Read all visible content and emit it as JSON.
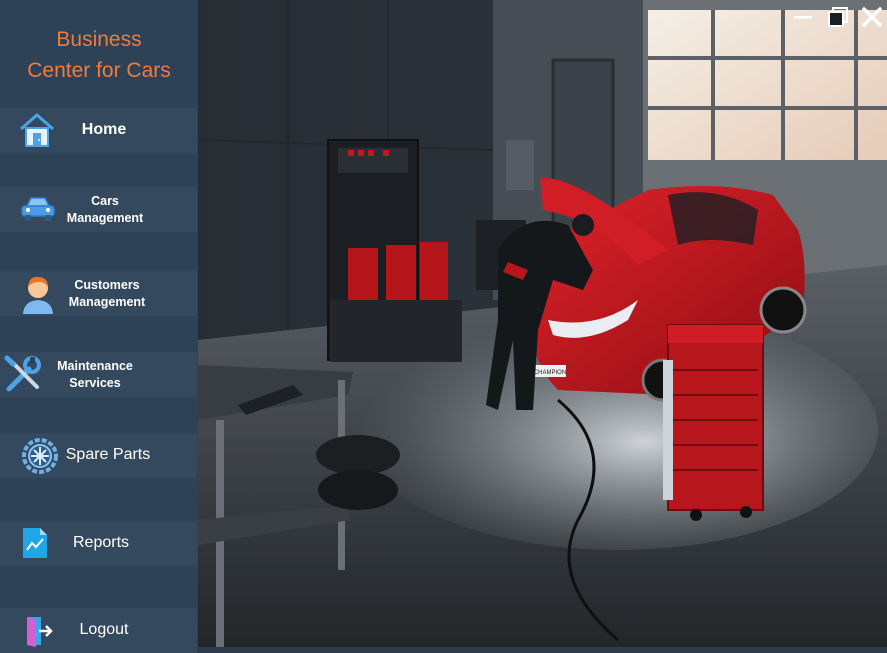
{
  "app": {
    "title_line1": "Business",
    "title_line2": "Center for Cars"
  },
  "nav": [
    {
      "id": "home",
      "line1": "Home",
      "line2": "",
      "icon": "house-icon"
    },
    {
      "id": "cars",
      "line1": "Cars",
      "line2": "Management",
      "icon": "car-icon"
    },
    {
      "id": "customers",
      "line1": "Customers",
      "line2": "Management",
      "icon": "user-icon"
    },
    {
      "id": "maintenance",
      "line1": "Maintenance",
      "line2": "Services",
      "icon": "wrench-screwdriver-icon"
    },
    {
      "id": "spareparts",
      "line1": "Spare Parts",
      "line2": "",
      "icon": "gear-wheel-icon"
    },
    {
      "id": "reports",
      "line1": "Reports",
      "line2": "",
      "icon": "report-chart-icon"
    },
    {
      "id": "logout",
      "line1": "Logout",
      "line2": "",
      "icon": "logout-door-icon"
    }
  ],
  "window_controls": {
    "minimize_icon": "minimize-icon",
    "restore_icon": "restore-icon",
    "close_icon": "close-icon"
  },
  "scene": {
    "image_label": "garage-mechanic-red-car-photo",
    "car_plate_text": "CHAMPION",
    "colors": {
      "accent": "#ee7b3f",
      "sidebar": "#2d4257",
      "item": "#34495e",
      "car_red": "#c0151c"
    }
  }
}
